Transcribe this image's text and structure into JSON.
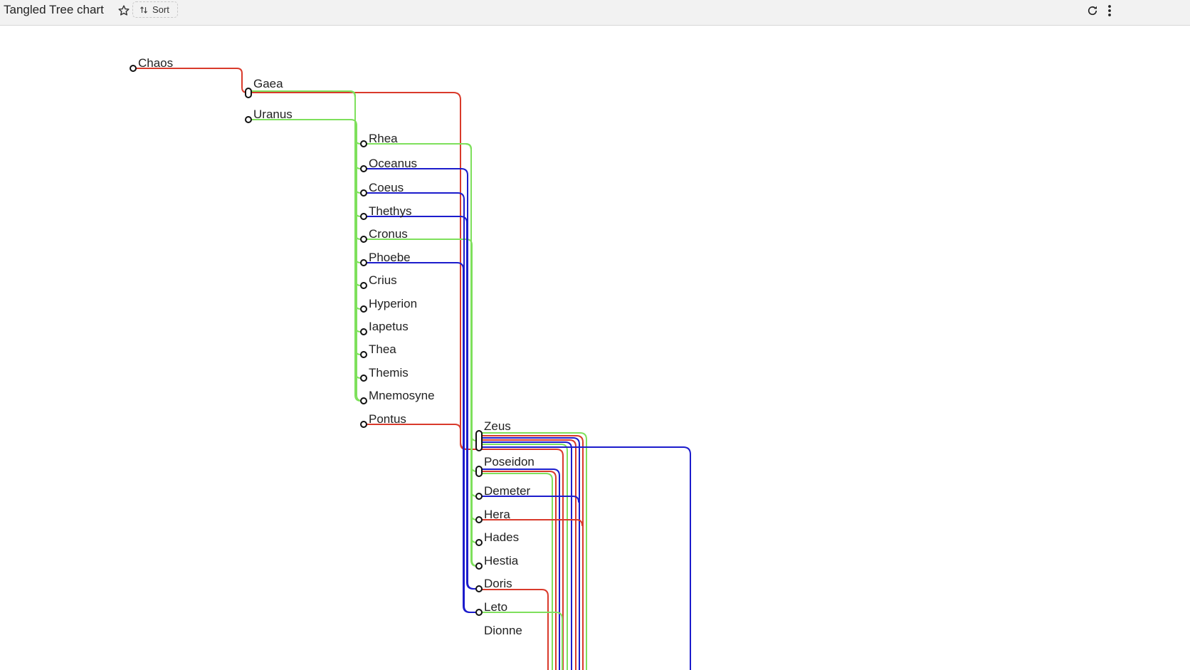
{
  "header": {
    "title": "Tangled Tree chart",
    "sort_label": "Sort"
  },
  "icons": {
    "favorite": "star-outline-icon",
    "sort": "sort-arrows-icon",
    "refresh": "refresh-icon",
    "more": "more-vert-icon"
  },
  "colors": {
    "red": "#d93a2b",
    "green": "#7ee05c",
    "blue": "#1c1ccc",
    "node_stroke": "#111111"
  },
  "chart_data": {
    "type": "tangled-tree",
    "levels": [
      [
        "Chaos"
      ],
      [
        "Gaea",
        "Uranus"
      ],
      [
        "Rhea",
        "Oceanus",
        "Coeus",
        "Thethys",
        "Cronus",
        "Phoebe",
        "Crius",
        "Hyperion",
        "Iapetus",
        "Thea",
        "Themis",
        "Mnemosyne",
        "Pontus"
      ],
      [
        "Zeus",
        "Poseidon",
        "Demeter",
        "Hera",
        "Hades",
        "Hestia",
        "Doris",
        "Leto",
        "Dionne"
      ]
    ],
    "links": [
      {
        "from": "Chaos",
        "to": "Gaea"
      },
      {
        "from": "Gaea",
        "to": "Rhea"
      },
      {
        "from": "Gaea",
        "to": "Oceanus"
      },
      {
        "from": "Gaea",
        "to": "Coeus"
      },
      {
        "from": "Gaea",
        "to": "Thethys"
      },
      {
        "from": "Gaea",
        "to": "Cronus"
      },
      {
        "from": "Gaea",
        "to": "Phoebe"
      },
      {
        "from": "Gaea",
        "to": "Crius"
      },
      {
        "from": "Gaea",
        "to": "Hyperion"
      },
      {
        "from": "Gaea",
        "to": "Iapetus"
      },
      {
        "from": "Gaea",
        "to": "Thea"
      },
      {
        "from": "Gaea",
        "to": "Themis"
      },
      {
        "from": "Gaea",
        "to": "Mnemosyne"
      },
      {
        "from": "Uranus",
        "to": "Rhea"
      },
      {
        "from": "Uranus",
        "to": "Mnemosyne"
      },
      {
        "from": "Gaea",
        "to": "Zeus"
      },
      {
        "from": "Pontus",
        "to": "Zeus"
      },
      {
        "from": "Rhea",
        "to": "Demeter"
      },
      {
        "from": "Rhea",
        "to": "Hestia"
      },
      {
        "from": "Cronus",
        "to": "Hades"
      },
      {
        "from": "Oceanus",
        "to": "Doris"
      },
      {
        "from": "Coeus",
        "to": "Leto"
      },
      {
        "from": "Phoebe",
        "to": "Leto"
      },
      {
        "from": "Thethys",
        "to": "Doris"
      }
    ]
  }
}
